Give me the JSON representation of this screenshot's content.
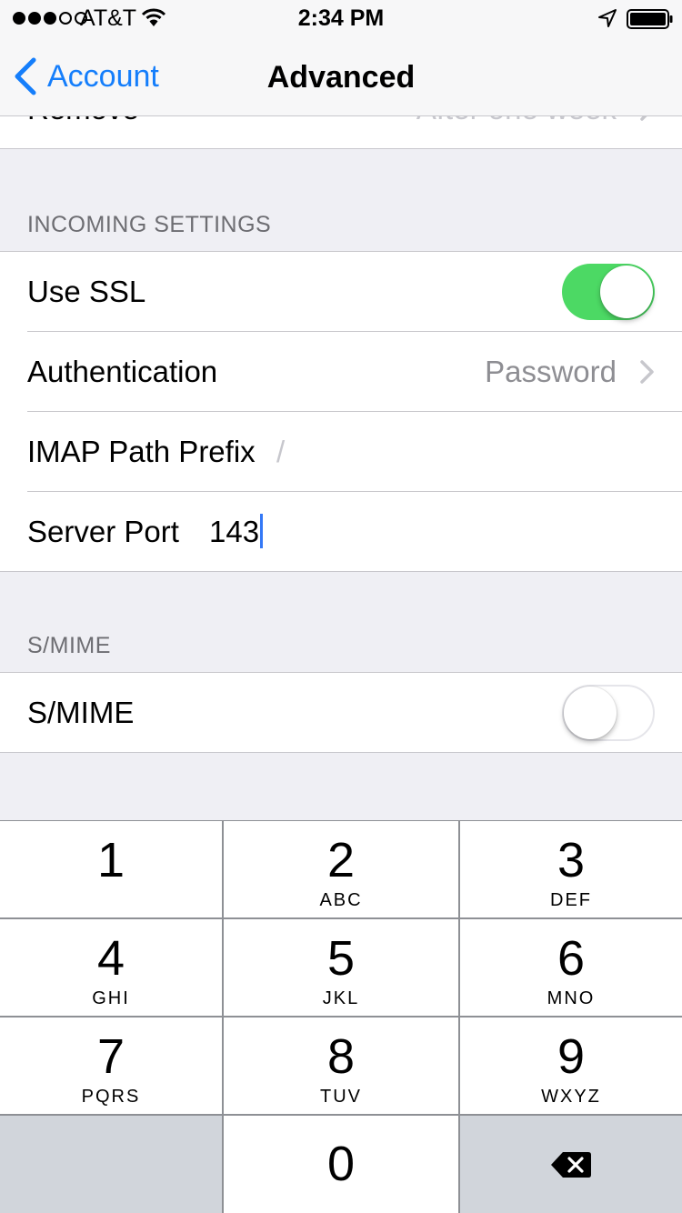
{
  "status_bar": {
    "carrier": "AT&T",
    "time": "2:34 PM",
    "signal_bars_filled": 3,
    "signal_bars_total": 5
  },
  "nav": {
    "back_label": "Account",
    "title": "Advanced"
  },
  "partial_row": {
    "label": "Remove",
    "value": "After one week"
  },
  "incoming_settings": {
    "header": "INCOMING SETTINGS",
    "use_ssl": {
      "label": "Use SSL",
      "on": true
    },
    "authentication": {
      "label": "Authentication",
      "value": "Password"
    },
    "imap_path_prefix": {
      "label": "IMAP Path Prefix",
      "value": "/"
    },
    "server_port": {
      "label": "Server Port",
      "value": "143"
    }
  },
  "smime": {
    "header": "S/MIME",
    "row": {
      "label": "S/MIME",
      "on": false
    }
  },
  "keypad": {
    "keys": [
      {
        "digit": "1",
        "letters": ""
      },
      {
        "digit": "2",
        "letters": "ABC"
      },
      {
        "digit": "3",
        "letters": "DEF"
      },
      {
        "digit": "4",
        "letters": "GHI"
      },
      {
        "digit": "5",
        "letters": "JKL"
      },
      {
        "digit": "6",
        "letters": "MNO"
      },
      {
        "digit": "7",
        "letters": "PQRS"
      },
      {
        "digit": "8",
        "letters": "TUV"
      },
      {
        "digit": "9",
        "letters": "WXYZ"
      },
      {
        "digit": "0",
        "letters": ""
      }
    ],
    "delete_icon": "backspace-icon"
  },
  "colors": {
    "accent": "#157efb",
    "switch_on": "#4cd964",
    "background": "#efeff4",
    "keypad_dark_key": "#d1d5db"
  }
}
